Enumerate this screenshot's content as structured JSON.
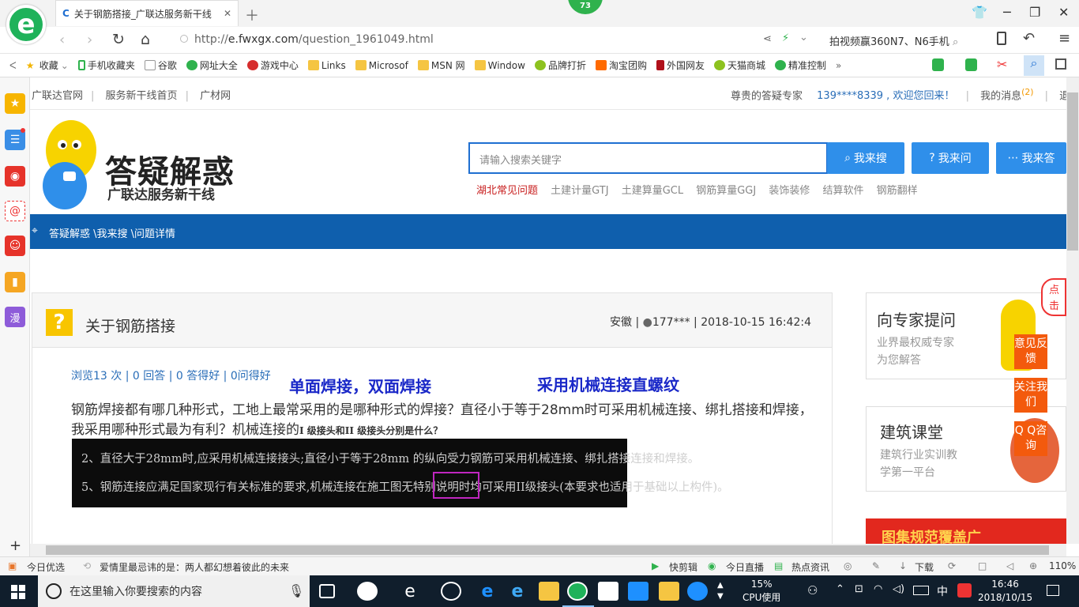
{
  "browser": {
    "tab_title": "关于钢筋搭接_广联达服务新干线",
    "notif_count": "73",
    "url_prefix": "http://",
    "url_host": "e.fwxgx.com",
    "url_path": "/question_1961049.html",
    "right_search": "拍视频赢360N7、N6手机",
    "bookmarks": [
      "收藏",
      "手机收藏夹",
      "谷歌",
      "网址大全",
      "游戏中心",
      "Links",
      "Microsof",
      "MSN 网",
      "Window",
      "品牌打折",
      "淘宝团购",
      "外国网友",
      "天猫商城",
      "精准控制"
    ],
    "zoom": "110%",
    "status_left1": "今日优选",
    "status_left2": "爱情里最忌讳的是：两人都幻想着彼此的未来",
    "status_items": [
      "快剪辑",
      "今日直播",
      "热点资讯",
      "下载"
    ]
  },
  "site": {
    "topnav": [
      "广联达官网",
      "服务新干线首页",
      "广材网"
    ],
    "expert": "尊贵的答疑专家",
    "user": "139****8339 , 欢迎您回来！",
    "messages": "我的消息",
    "msg_count": "(2)",
    "logout": "退出",
    "brand": "答疑解惑",
    "brand_sub": "广联达服务新干线",
    "search_placeholder": "请输入搜索关键字",
    "btn_search": "我来搜",
    "btn_ask": "我来问",
    "btn_answer": "我来答",
    "hot_first": "湖北常见问题",
    "hot_links": [
      "土建计量GTJ",
      "土建算量GCL",
      "钢筋算量GGJ",
      "装饰装修",
      "结算软件",
      "钢筋翻样"
    ],
    "breadcrumb": "答疑解惑 \\我来搜 \\问题详情"
  },
  "question": {
    "title": "关于钢筋搭接",
    "region": "安徽",
    "user": "177***",
    "datetime": "2018-10-15 16:42:4",
    "stats": "浏览13 次 | 0 回答 | 0 答得好 | 0问得好",
    "annotation1": "单面焊接，双面焊接",
    "annotation2": "采用机械连接直螺纹",
    "body_main": "钢筋焊接都有哪几种形式，工地上最常采用的是哪种形式的焊接？直径小于等于28mm时可采用机械连接、绑扎搭接和焊接，我采用哪种形式最为有利？机械连接的",
    "body_tail": "I 级接头和II 级接头分别是什么？",
    "img_line1": "2、直径大于28mm时,应采用机械连接接头;直径小于等于28mm 的纵向受力钢筋可采用机械连接、绑扎搭接连接和焊接。",
    "img_line2": "5、钢筋连接应满足国家现行有关标准的要求,机械连接在施工图无特别说明时均可采用II级接头(本要求也适用于基础以上构件)。"
  },
  "right": {
    "box1_title": "向专家提问",
    "box1_sub1": "业界最权威专家",
    "box1_sub2": "为您解答",
    "box2_title": "建筑课堂",
    "box2_sub1": "建筑行业实训教",
    "box2_sub2": "学第一平台",
    "tag1": "意见反馈",
    "tag2": "关注我们",
    "tag3": "Q Q咨询",
    "banner": "图集规范覆盖广",
    "bubble": "点击提问"
  },
  "taskbar": {
    "search": "在这里输入你要搜索的内容",
    "cpu_pct": "15%",
    "cpu_label": "CPU使用",
    "ime": "中",
    "time": "16:46",
    "date": "2018/10/15"
  }
}
